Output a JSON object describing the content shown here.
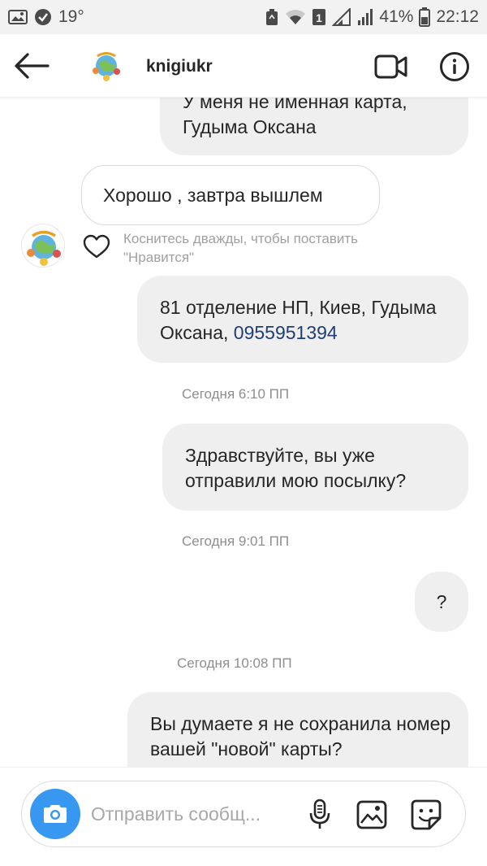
{
  "status_bar": {
    "temperature": "19°",
    "sim_badge": "1",
    "battery_percent": "41%",
    "time": "22:12"
  },
  "header": {
    "username": "knigiukr"
  },
  "messages": [
    {
      "direction": "outgoing",
      "text": "У меня не именная карта, Гудыма Оксана",
      "partially_hidden": true
    },
    {
      "direction": "incoming",
      "text": "Хорошо , завтра вышлем"
    },
    {
      "like_hint": "Коснитесь дважды, чтобы поставить \"Нравится\""
    },
    {
      "direction": "outgoing",
      "text_prefix": "81 отделение НП, Киев, Гудыма Оксана, ",
      "phone": "0955951394"
    },
    {
      "timestamp": "Сегодня 6:10 ПП"
    },
    {
      "direction": "outgoing",
      "text": "Здравствуйте, вы уже отправили мою посылку?"
    },
    {
      "timestamp": "Сегодня 9:01 ПП"
    },
    {
      "direction": "outgoing",
      "text": "?"
    },
    {
      "timestamp": "Сегодня 10:08 ПП"
    },
    {
      "direction": "outgoing",
      "text": "Вы думаете я не сохранила номер вашей \"новой\" карты?"
    }
  ],
  "composer": {
    "placeholder": "Отправить сообщ..."
  },
  "colors": {
    "accent": "#3897f0",
    "outgoing_bubble": "#efefef",
    "link": "#1f3e75",
    "hint_text": "#a0a0a0"
  },
  "icons": {
    "back": "arrow-left-icon",
    "video": "video-camera-icon",
    "info": "info-circle-icon",
    "heart": "heart-outline-icon",
    "camera": "camera-icon",
    "mic": "microphone-icon",
    "gallery": "image-icon",
    "sticker": "sticker-icon"
  }
}
